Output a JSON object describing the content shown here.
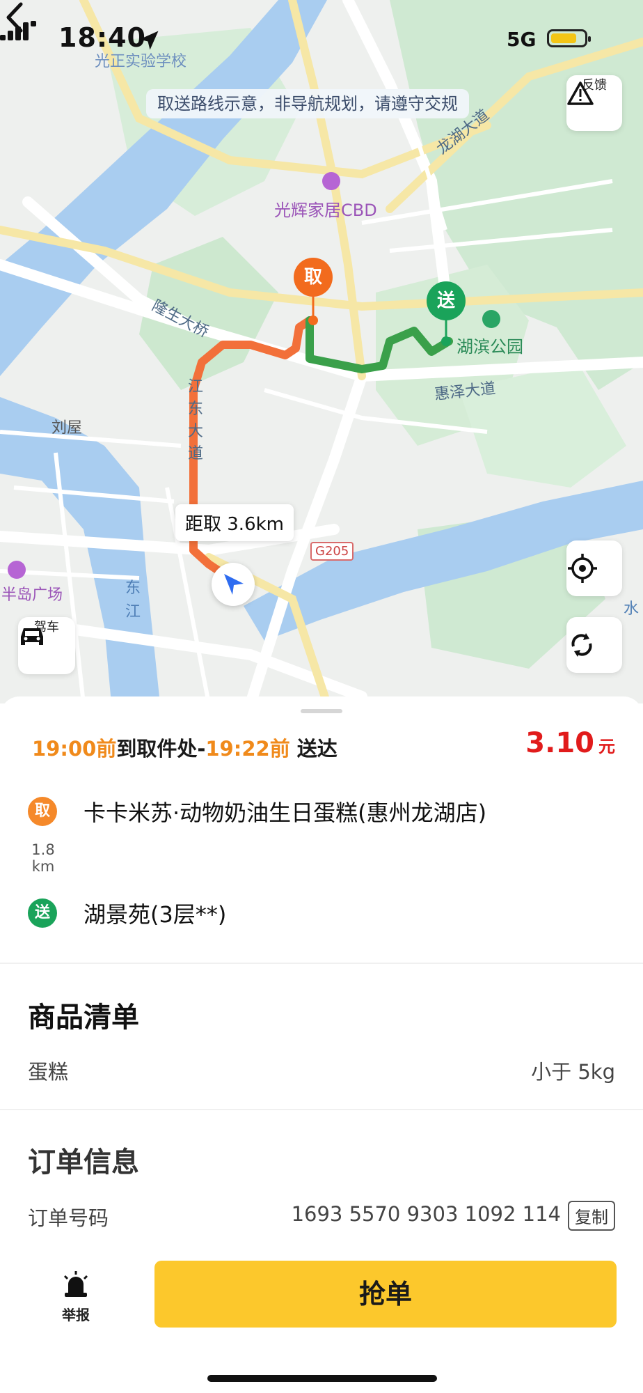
{
  "status_bar": {
    "time": "18:40",
    "network": "5G"
  },
  "map": {
    "notice": "取送路线示意，非导航规划，请遵守交规",
    "feedback_label": "反馈",
    "drive_label": "驾车",
    "distance_bubble": "距取 3.6km",
    "pickup_marker": "取",
    "delivery_marker": "送",
    "road_badge": "G205",
    "place_labels": {
      "school": "光正实验学校",
      "cbd": "光辉家居CBD",
      "longhu_road": "龙湖大道",
      "bridge": "隆生大桥",
      "park": "湖滨公园",
      "huize_road": "惠泽大道",
      "jiangdong_road": "江东大道",
      "liuwu": "刘屋",
      "bandao": "半岛广场",
      "dongjiang": "东江",
      "water": "水"
    },
    "colors": {
      "pickup_route": "#f2703a",
      "delivery_route": "#3aa04a",
      "pickup_marker": "#f26b1d",
      "delivery_marker": "#1aa35a"
    }
  },
  "order": {
    "timeline": {
      "pickup_time": "19:00",
      "pickup_before": "前",
      "pickup_text": "到取件处-",
      "delivery_time": "19:22",
      "delivery_before": "前",
      "delivery_text": " 送达"
    },
    "price": "3.10",
    "price_unit": "元",
    "pickup_icon": "取",
    "pickup_name": "卡卡米苏·动物奶油生日蛋糕(惠州龙湖店)",
    "distance_value": "1.8",
    "distance_unit": "km",
    "delivery_icon": "送",
    "delivery_name": "湖景苑(3层**)"
  },
  "goods": {
    "title": "商品清单",
    "item_name": "蛋糕",
    "item_weight": "小于 5kg"
  },
  "order_info": {
    "title": "订单信息",
    "number_label": "订单号码",
    "number_value": "1693 5570 9303 1092 114",
    "copy_label": "复制"
  },
  "bottom": {
    "report_label": "举报",
    "grab_label": "抢单"
  }
}
